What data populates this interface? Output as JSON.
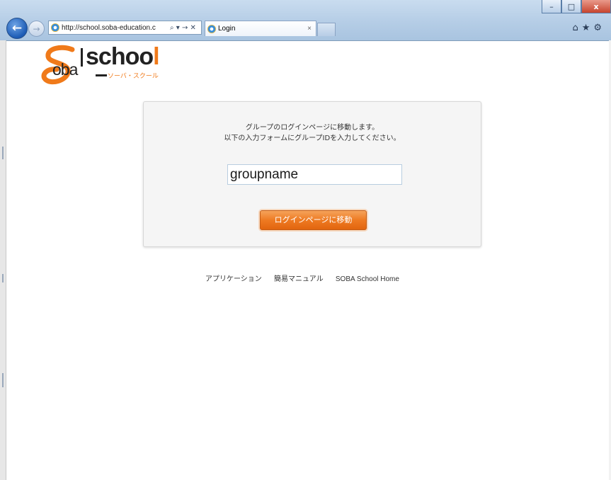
{
  "browser": {
    "address_url": "http://school.soba-education.c",
    "address_tools": "⌕ ▾ → ✕",
    "tab_title": "Login",
    "tab_close": "×",
    "toolbar_icons": "⌂★⚙",
    "window_controls": {
      "minimize": "–",
      "maximize": "□",
      "close": "x"
    }
  },
  "logo": {
    "wordmark_main": "schoo",
    "wordmark_last": "l",
    "wordmark_sub": "oba",
    "kana": "ソーバ・スクール"
  },
  "login": {
    "message_line1": "グループのログインページに移動します。",
    "message_line2": "以下の入力フォームにグループIDを入力してください。",
    "group_id_value": "groupname",
    "submit_label": "ログインページに移動"
  },
  "footer": {
    "links": [
      "アプリケーション",
      "簡易マニュアル",
      "SOBA School Home"
    ]
  },
  "colors": {
    "accent_orange": "#ee7a22",
    "chrome_blue": "#b5cde6"
  }
}
